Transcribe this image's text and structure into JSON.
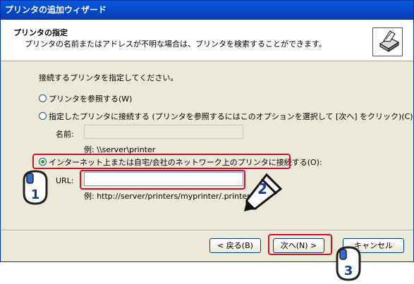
{
  "window": {
    "title": "プリンタの追加ウィザード"
  },
  "header": {
    "title": "プリンタの指定",
    "subtitle": "プリンタの名前またはアドレスが不明な場合は、プリンタを検索することができます。",
    "icon": "printer-icon"
  },
  "main": {
    "prompt": "接続するプリンタを指定してください。",
    "options": [
      {
        "label": "プリンタを参照する(W)",
        "selected": false
      },
      {
        "label": "指定したプリンタに接続する (プリンタを参照するにはこのオプションを選択して [次へ] をクリック)(C):",
        "selected": false
      },
      {
        "label": "インターネット上または自宅/会社のネットワーク上のプリンタに接続する(O):",
        "selected": true
      }
    ],
    "name_label": "名前:",
    "name_value": "",
    "name_example": "例: \\\\server\\printer",
    "url_label": "URL:",
    "url_value": "",
    "url_example": "例: http://server/printers/myprinter/.printer"
  },
  "buttons": {
    "back": "< 戻る(B)",
    "next": "次へ(N) >",
    "cancel": "キャンセル"
  },
  "annotations": {
    "step1": "1",
    "step2": "2",
    "step3": "3",
    "highlight_color": "#d0102a"
  }
}
